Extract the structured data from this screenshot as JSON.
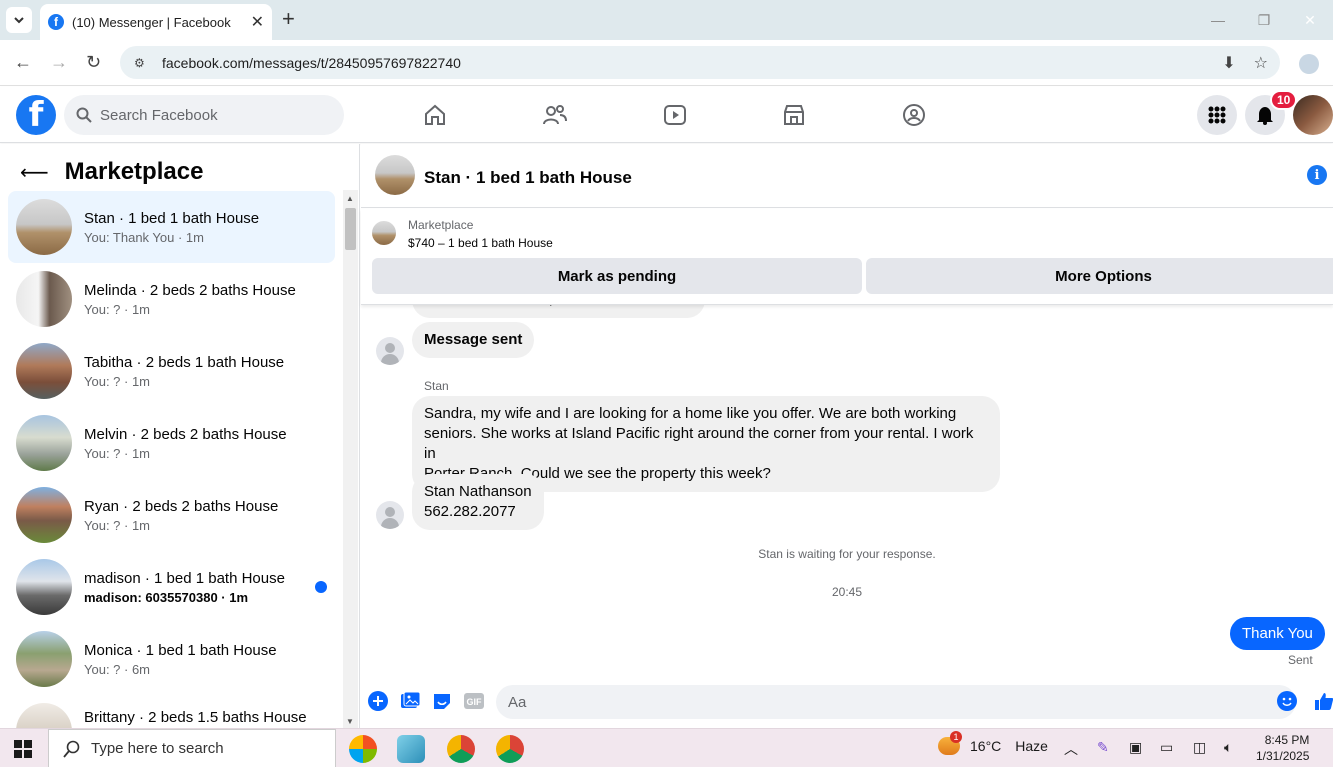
{
  "browser": {
    "tab_title": "(10) Messenger | Facebook",
    "url": "facebook.com/messages/t/28450957697822740"
  },
  "fb": {
    "search_placeholder": "Search Facebook",
    "notification_count": "10"
  },
  "left": {
    "title": "Marketplace",
    "conversations": [
      {
        "name": "Stan · 1 bed 1 bath House",
        "preview": "You: Thank You · 1m",
        "active": true,
        "unread": false
      },
      {
        "name": "Melinda · 2 beds 2 baths House",
        "preview": "You: ? · 1m",
        "active": false,
        "unread": false
      },
      {
        "name": "Tabitha · 2 beds 1 bath House",
        "preview": "You: ? · 1m",
        "active": false,
        "unread": false
      },
      {
        "name": "Melvin · 2 beds 2 baths House",
        "preview": "You: ? · 1m",
        "active": false,
        "unread": false
      },
      {
        "name": "Ryan · 2 beds 2 baths House",
        "preview": "You: ? · 1m",
        "active": false,
        "unread": false
      },
      {
        "name": "madison · 1 bed 1 bath House",
        "preview": "madison: 6035570380 · 1m",
        "active": false,
        "unread": true
      },
      {
        "name": "Monica · 1 bed 1 bath House",
        "preview": "You: ? · 6m",
        "active": false,
        "unread": false
      },
      {
        "name": "Brittany · 2 beds 1.5 baths House",
        "preview": "",
        "active": false,
        "unread": false
      }
    ]
  },
  "chat": {
    "title": "Stan · 1 bed 1 bath House",
    "marketplace_label": "Marketplace",
    "listing": "$740 – 1 bed 1 bath House",
    "mark_pending": "Mark as pending",
    "more_options": "More Options",
    "partial_message": "Hi Sandra Thomas, is this still available?",
    "message_sent": "Message sent",
    "sender": "Stan",
    "long_message_lines": [
      "Sandra, my wife and I are looking for a home like you offer. We are both working",
      "seniors. She works at Island Pacific right around the corner from your rental. I work in",
      "Porter Ranch. Could we see the property this week?"
    ],
    "contact_name": "Stan Nathanson",
    "contact_phone": "562.282.2077",
    "waiting": "Stan is waiting for your response.",
    "time": "20:45",
    "my_message": "Thank You",
    "sent_status": "Sent",
    "composer_placeholder": "Aa"
  },
  "taskbar": {
    "search_placeholder": "Type here to search",
    "weather_temp": "16°C",
    "weather_desc": "Haze",
    "weather_badge": "1",
    "time": "8:45 PM",
    "date": "1/31/2025"
  },
  "colors": {
    "fb_blue": "#1877f2",
    "messenger_blue": "#0866ff",
    "active_row": "#ebf5ff",
    "badge_red": "#e41e3f"
  }
}
